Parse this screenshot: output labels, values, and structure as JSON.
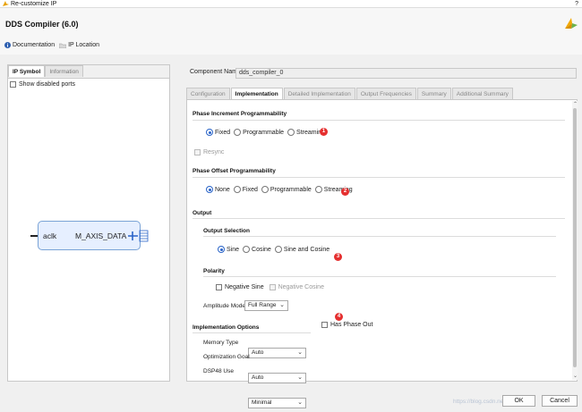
{
  "window": {
    "title": "Re-customize IP",
    "help": "?"
  },
  "header": {
    "component_title": "DDS Compiler (6.0)"
  },
  "toolbar": {
    "documentation": "Documentation",
    "ip_location": "IP Location"
  },
  "left": {
    "tabs": [
      "IP Symbol",
      "Information"
    ],
    "show_disabled_ports": "Show disabled ports",
    "symbol": {
      "port_left": "aclk",
      "port_right": "M_AXIS_DATA"
    }
  },
  "right": {
    "component_name_label": "Component Name",
    "component_name_value": "dds_compiler_0",
    "tabs": [
      "Configuration",
      "Implementation",
      "Detailed Implementation",
      "Output Frequencies",
      "Summary",
      "Additional Summary"
    ],
    "phase_increment": {
      "title": "Phase Increment Programmability",
      "options": [
        "Fixed",
        "Programmable",
        "Streaming"
      ],
      "selected": "Fixed",
      "badge": "1",
      "resync": "Resync"
    },
    "phase_offset": {
      "title": "Phase Offset Programmability",
      "options": [
        "None",
        "Fixed",
        "Programmable",
        "Streaming"
      ],
      "selected": "None",
      "badge": "2"
    },
    "output": {
      "title": "Output",
      "selection_title": "Output Selection",
      "options": [
        "Sine",
        "Cosine",
        "Sine and Cosine"
      ],
      "selected": "Sine",
      "badge": "3",
      "polarity_title": "Polarity",
      "negative_sine": "Negative Sine",
      "negative_cosine": "Negative Cosine",
      "amplitude_label": "Amplitude Mode",
      "amplitude_value": "Full Range",
      "badge4": "4",
      "has_phase_out": "Has Phase Out"
    },
    "impl_options": {
      "title": "Implementation Options",
      "memory_type_label": "Memory Type",
      "memory_type_value": "Auto",
      "optimization_goal_label": "Optimization Goal",
      "optimization_goal_value": "Auto",
      "dsp48_label": "DSP48 Use",
      "dsp48_value": "Minimal"
    }
  },
  "footer": {
    "ok": "OK",
    "cancel": "Cancel",
    "watermark": "https://blog.csdn.net/..."
  },
  "colors": {
    "accent": "#2a64c8",
    "badge": "#e53030",
    "symbol_fill": "#e6efff"
  }
}
